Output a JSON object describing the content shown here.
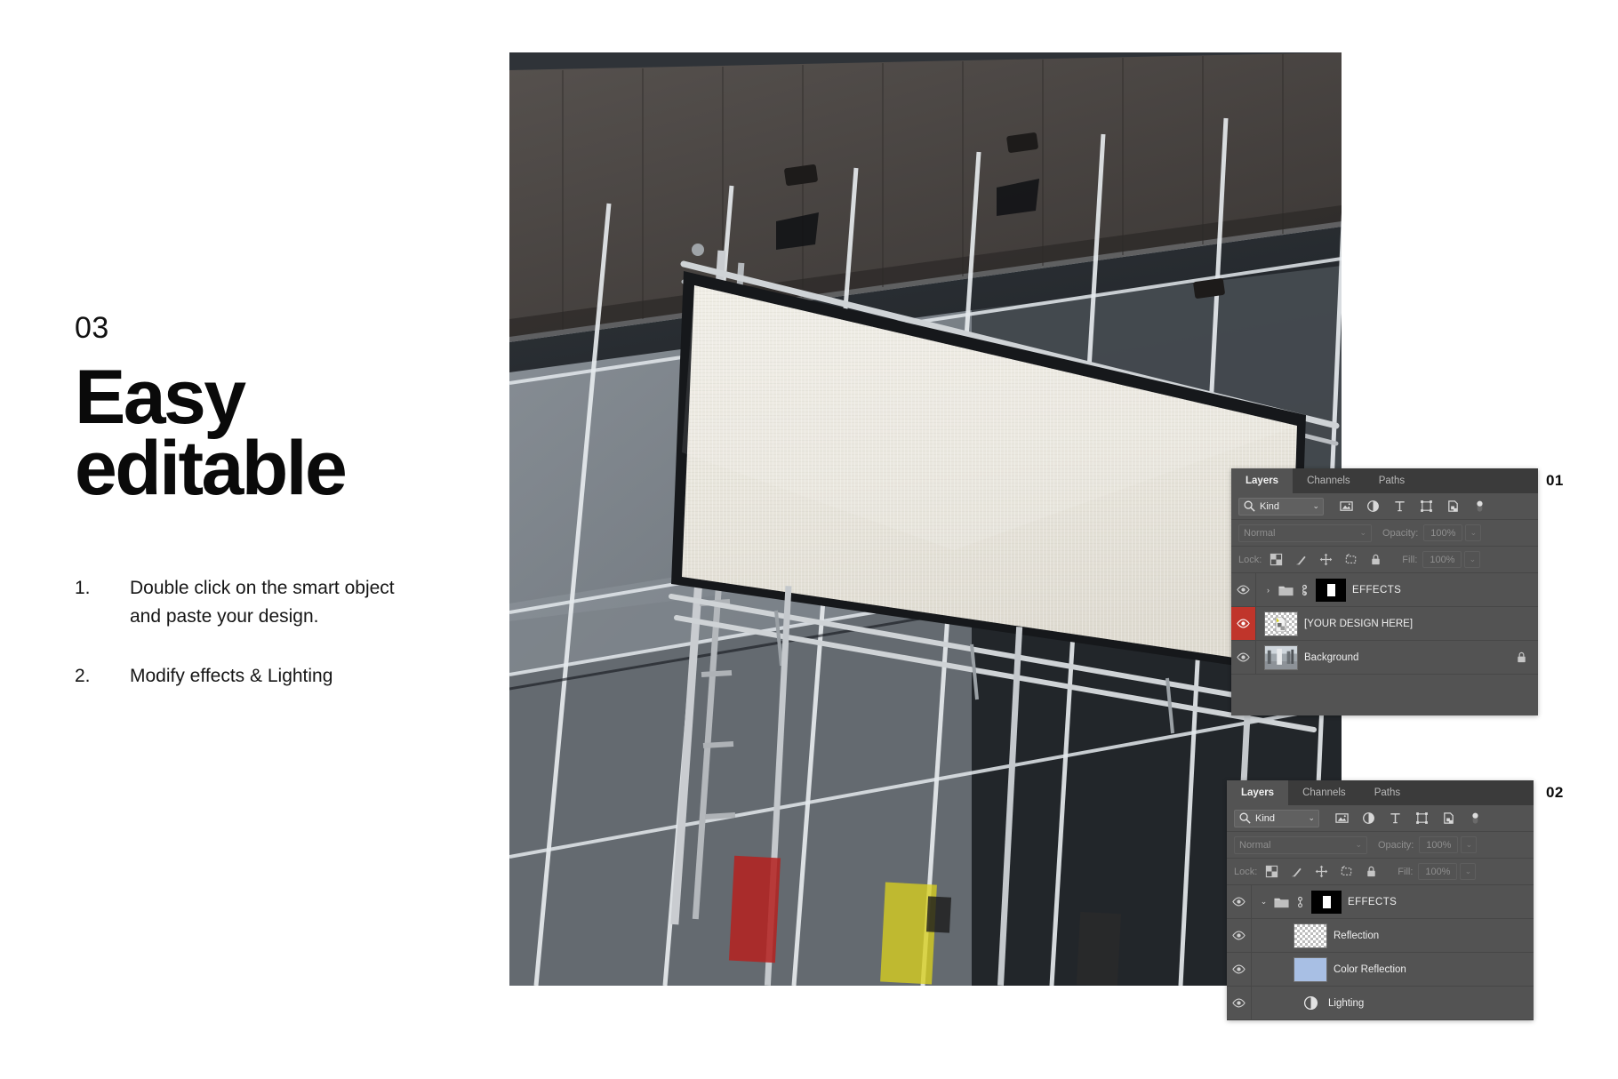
{
  "slide": {
    "step_number": "03",
    "headline_line1": "Easy",
    "headline_line2": "editable",
    "steps": [
      {
        "index": "1.",
        "text": "Double click on the smart object and paste your design."
      },
      {
        "index": "2.",
        "text": "Modify effects & Lighting"
      }
    ]
  },
  "photo": {
    "alt_name": "billboard-mockup-photo",
    "description": "Low angle photo of a glass facade building with a large blank white billboard banner mounted on scaffolding",
    "canvas_color": "#e9e7e0",
    "glass_dark": "#23262a",
    "glass_mid": "#7d838a",
    "sky_color": "#dfe6ec",
    "roof_color": "#474341"
  },
  "panels": [
    {
      "id": "01",
      "index_label": "01",
      "tabs": [
        {
          "label": "Layers",
          "active": true
        },
        {
          "label": "Channels",
          "active": false
        },
        {
          "label": "Paths",
          "active": false
        }
      ],
      "filter": {
        "search_icon": "search-icon",
        "value": "Kind",
        "caret": "⌄",
        "icons": [
          "pixel-layer-filter-icon",
          "adjustment-layer-filter-icon",
          "type-layer-filter-icon",
          "shape-layer-filter-icon",
          "smart-object-filter-icon",
          "filter-toggle-switch"
        ]
      },
      "blend": {
        "mode": "Normal",
        "caret": "⌄",
        "opacity_label": "Opacity:",
        "opacity_value": "100%",
        "stepper": "⌄"
      },
      "lock": {
        "label": "Lock:",
        "icons": [
          "lock-transparent-pixels-icon",
          "lock-image-pixels-icon",
          "lock-position-icon",
          "lock-artboard-nesting-icon",
          "lock-all-icon"
        ],
        "fill_label": "Fill:",
        "fill_value": "100%",
        "stepper": "⌄"
      },
      "layers": [
        {
          "name": "EFFECTS",
          "type": "group",
          "expanded": false,
          "arrow": "›",
          "visible": true,
          "selected": false,
          "has_mask": true,
          "linked": true,
          "locked": false
        },
        {
          "name": "[YOUR DESIGN HERE]",
          "type": "smart-object",
          "visible": true,
          "selected": true,
          "thumbnail": "checkerboard-with-smart-object-badge",
          "locked": false
        },
        {
          "name": "Background",
          "type": "image",
          "visible": true,
          "selected": false,
          "thumbnail": "building-photo-thumbnail",
          "locked": true
        }
      ]
    },
    {
      "id": "02",
      "index_label": "02",
      "tabs": [
        {
          "label": "Layers",
          "active": true
        },
        {
          "label": "Channels",
          "active": false
        },
        {
          "label": "Paths",
          "active": false
        }
      ],
      "filter": {
        "search_icon": "search-icon",
        "value": "Kind",
        "caret": "⌄",
        "icons": [
          "pixel-layer-filter-icon",
          "adjustment-layer-filter-icon",
          "type-layer-filter-icon",
          "shape-layer-filter-icon",
          "smart-object-filter-icon",
          "filter-toggle-switch"
        ]
      },
      "blend": {
        "mode": "Normal",
        "caret": "⌄",
        "opacity_label": "Opacity:",
        "opacity_value": "100%",
        "stepper": "⌄"
      },
      "lock": {
        "label": "Lock:",
        "icons": [
          "lock-transparent-pixels-icon",
          "lock-image-pixels-icon",
          "lock-position-icon",
          "lock-artboard-nesting-icon",
          "lock-all-icon"
        ],
        "fill_label": "Fill:",
        "fill_value": "100%",
        "stepper": "⌄"
      },
      "layers": [
        {
          "name": "EFFECTS",
          "type": "group",
          "expanded": true,
          "arrow": "⌄",
          "visible": true,
          "selected": false,
          "has_mask": true,
          "linked": true,
          "locked": false
        },
        {
          "name": "Reflection",
          "type": "pixel",
          "visible": true,
          "selected": false,
          "thumbnail": "transparent-checkerboard",
          "locked": false
        },
        {
          "name": "Color Reflection",
          "type": "pixel",
          "visible": true,
          "selected": false,
          "thumbnail": "solid-blue-fill",
          "thumbnail_color": "#a8bfe4",
          "locked": false
        },
        {
          "name": "Lighting",
          "type": "adjustment",
          "visible": true,
          "selected": false,
          "thumbnail": "adjustment-half-circle-icon",
          "locked": false
        }
      ]
    }
  ]
}
